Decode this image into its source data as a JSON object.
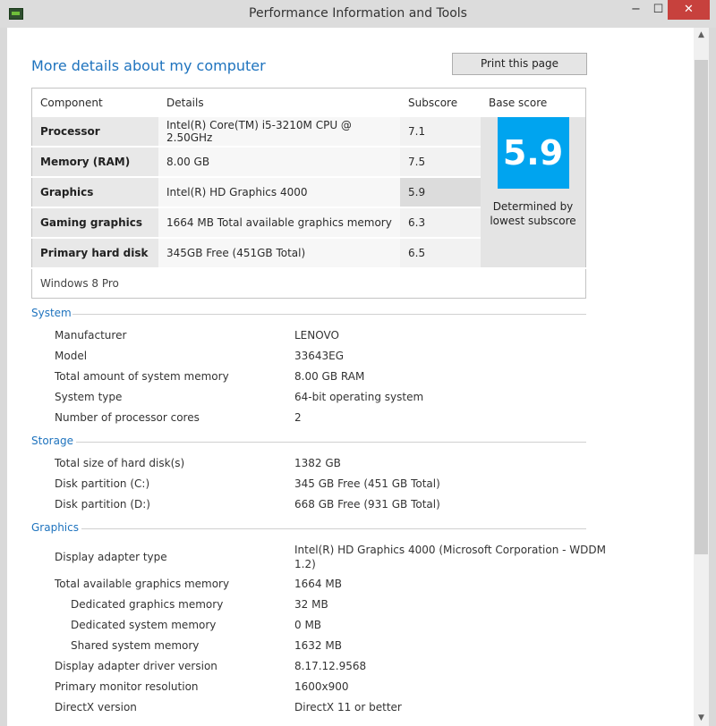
{
  "window": {
    "title": "Performance Information and Tools",
    "min": "−",
    "max": "☐",
    "close": "✕"
  },
  "heading": "More details about my computer",
  "print_label": "Print this page",
  "table": {
    "headers": {
      "component": "Component",
      "details": "Details",
      "subscore": "Subscore",
      "base": "Base score"
    },
    "rows": [
      {
        "component": "Processor",
        "details": "Intel(R) Core(TM) i5-3210M CPU @ 2.50GHz",
        "subscore": "7.1"
      },
      {
        "component": "Memory (RAM)",
        "details": "8.00 GB",
        "subscore": "7.5"
      },
      {
        "component": "Graphics",
        "details": "Intel(R) HD Graphics 4000",
        "subscore": "5.9"
      },
      {
        "component": "Gaming graphics",
        "details": "1664 MB Total available graphics memory",
        "subscore": "6.3"
      },
      {
        "component": "Primary hard disk",
        "details": "345GB Free (451GB Total)",
        "subscore": "6.5"
      }
    ],
    "base_score": "5.9",
    "base_caption_1": "Determined by",
    "base_caption_2": "lowest subscore",
    "os": "Windows 8 Pro",
    "accent": "#00a4ef"
  },
  "system": {
    "title": "System",
    "rows": [
      {
        "label": "Manufacturer",
        "value": "LENOVO"
      },
      {
        "label": "Model",
        "value": "33643EG"
      },
      {
        "label": "Total amount of system memory",
        "value": "8.00 GB RAM"
      },
      {
        "label": "System type",
        "value": "64-bit operating system"
      },
      {
        "label": "Number of processor cores",
        "value": "2"
      }
    ]
  },
  "storage": {
    "title": "Storage",
    "rows": [
      {
        "label": "Total size of hard disk(s)",
        "value": "1382 GB"
      },
      {
        "label": "Disk partition (C:)",
        "value": "345 GB Free (451 GB Total)"
      },
      {
        "label": "Disk partition (D:)",
        "value": "668 GB Free (931 GB Total)"
      }
    ]
  },
  "graphics": {
    "title": "Graphics",
    "rows": [
      {
        "label": "Display adapter type",
        "value": "Intel(R) HD Graphics 4000 (Microsoft Corporation - WDDM",
        "value2": "1.2)"
      },
      {
        "label": "Total available graphics memory",
        "value": "1664 MB"
      },
      {
        "label": "Dedicated graphics memory",
        "value": "32 MB"
      },
      {
        "label": "Dedicated system memory",
        "value": "0 MB"
      },
      {
        "label": "Shared system memory",
        "value": "1632 MB"
      },
      {
        "label": "Display adapter driver version",
        "value": "8.17.12.9568"
      },
      {
        "label": "Primary monitor resolution",
        "value": "1600x900"
      },
      {
        "label": "DirectX version",
        "value": "DirectX 11 or better"
      }
    ]
  }
}
